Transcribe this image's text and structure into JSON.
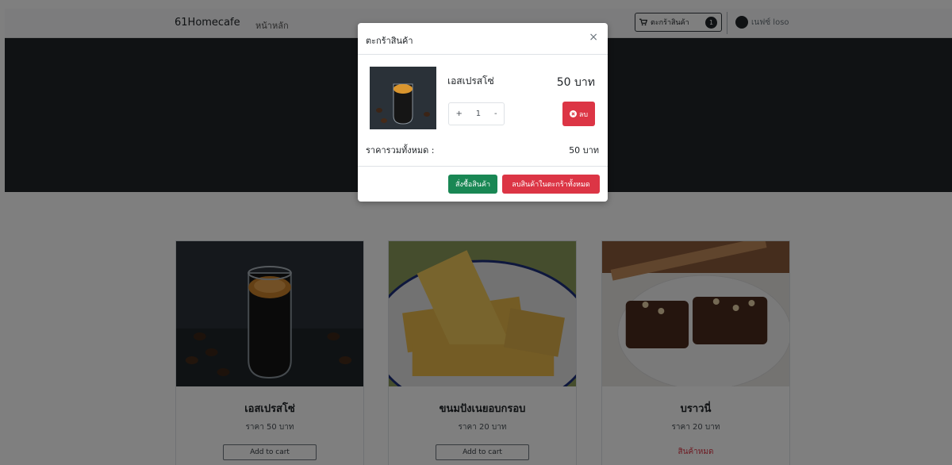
{
  "navbar": {
    "brand": "61Homecafe",
    "home_link": "หน้าหลัก",
    "cart_label": "ตะกร้าสินค้า",
    "cart_count": "1",
    "user_name": "เนฟซ์ loso"
  },
  "products": [
    {
      "name": "เอสเปรสโซ่",
      "price": "ราคา 50 บาท",
      "action": "Add to cart"
    },
    {
      "name": "ขนมปังเนยอบกรอบ",
      "price": "ราคา 20 บาท",
      "action": "Add to cart"
    },
    {
      "name": "บราวนี่",
      "price": "ราคา 20 บาท",
      "status": "สินค้าหมด"
    }
  ],
  "modal": {
    "title": "ตะกร้าสินค้า",
    "close": "×",
    "item": {
      "name": "เอสเปรสโซ่",
      "price": "50 บาท",
      "qty_plus": "+",
      "qty": "1",
      "qty_minus": "-",
      "delete_label": "ลบ"
    },
    "total_label": "ราคารวมทั้งหมด :",
    "total_value": "50 บาท",
    "order_button": "สั่งซื้อสินค้า",
    "clear_button": "ลบสินค้าในตะกร้าทั้งหมด"
  },
  "colors": {
    "hero": "#212529",
    "success": "#198754",
    "danger": "#dc3545"
  }
}
